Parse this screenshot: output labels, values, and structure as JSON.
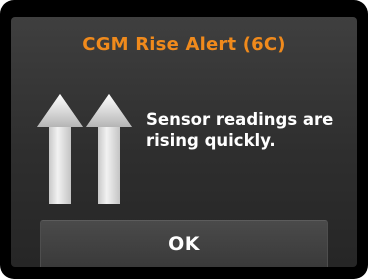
{
  "alert": {
    "title": "CGM Rise Alert (6C)",
    "message_line1": "Sensor readings are",
    "message_line2": "rising quickly.",
    "icon": "double-up-arrow-icon"
  },
  "buttons": {
    "ok_label": "OK"
  },
  "colors": {
    "title": "#f08a1c",
    "text": "#ffffff",
    "screen_background": "#333333",
    "frame": "#000000"
  }
}
